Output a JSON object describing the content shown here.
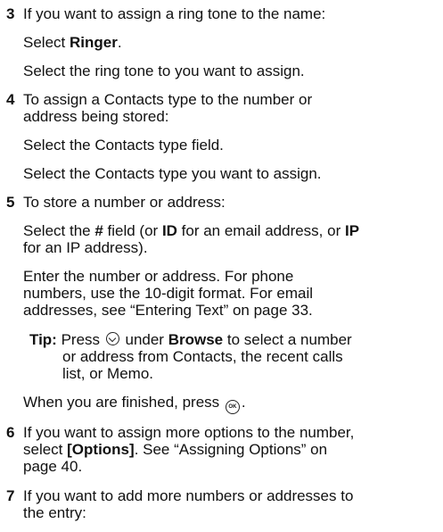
{
  "steps": [
    {
      "num": "3",
      "intro": "If you want to assign a ring tone to the name:",
      "a_prefix": "Select ",
      "a_bold": "Ringer",
      "a_suffix": ".",
      "b": "Select the ring tone to you want to assign."
    },
    {
      "num": "4",
      "intro1": "To assign a Contacts type to the number or",
      "intro2": "address being stored:",
      "a": "Select the Contacts type field.",
      "b": "Select the Contacts type you want to assign."
    },
    {
      "num": "5",
      "intro": "To store a number or address:",
      "sel_1": "Select the ",
      "sel_hash": "#",
      "sel_2": " field (or ",
      "sel_id": "ID",
      "sel_3": " for an email address, or ",
      "sel_ip": "IP",
      "sel_line2": "for an IP address).",
      "enter1": "Enter the number or address. For phone",
      "enter2": "numbers, use the 10-digit format. For email",
      "enter3": "addresses, see “Entering Text” on page 33.",
      "tip_label": "Tip:",
      "tip_1": " Press ",
      "tip_2": " under ",
      "tip_browse": "Browse",
      "tip_3": " to select a number",
      "tip_line2": "or address from Contacts, the recent calls",
      "tip_line3": "list, or Memo.",
      "finish": "When you are finished, press ",
      "finish_end": "."
    },
    {
      "num": "6",
      "line1": "If you want to assign more options to the number,",
      "line2_1": "select ",
      "line2_bold": "[Options]",
      "line2_2": ". See “Assigning Options” on",
      "line3": "page 40."
    },
    {
      "num": "7",
      "line1": "If you want to add more numbers or addresses to",
      "line2": "the entry:"
    }
  ],
  "icons": {
    "softkey": "left-softkey-icon",
    "ok": "ok-key-icon",
    "ok_text": "OK"
  }
}
